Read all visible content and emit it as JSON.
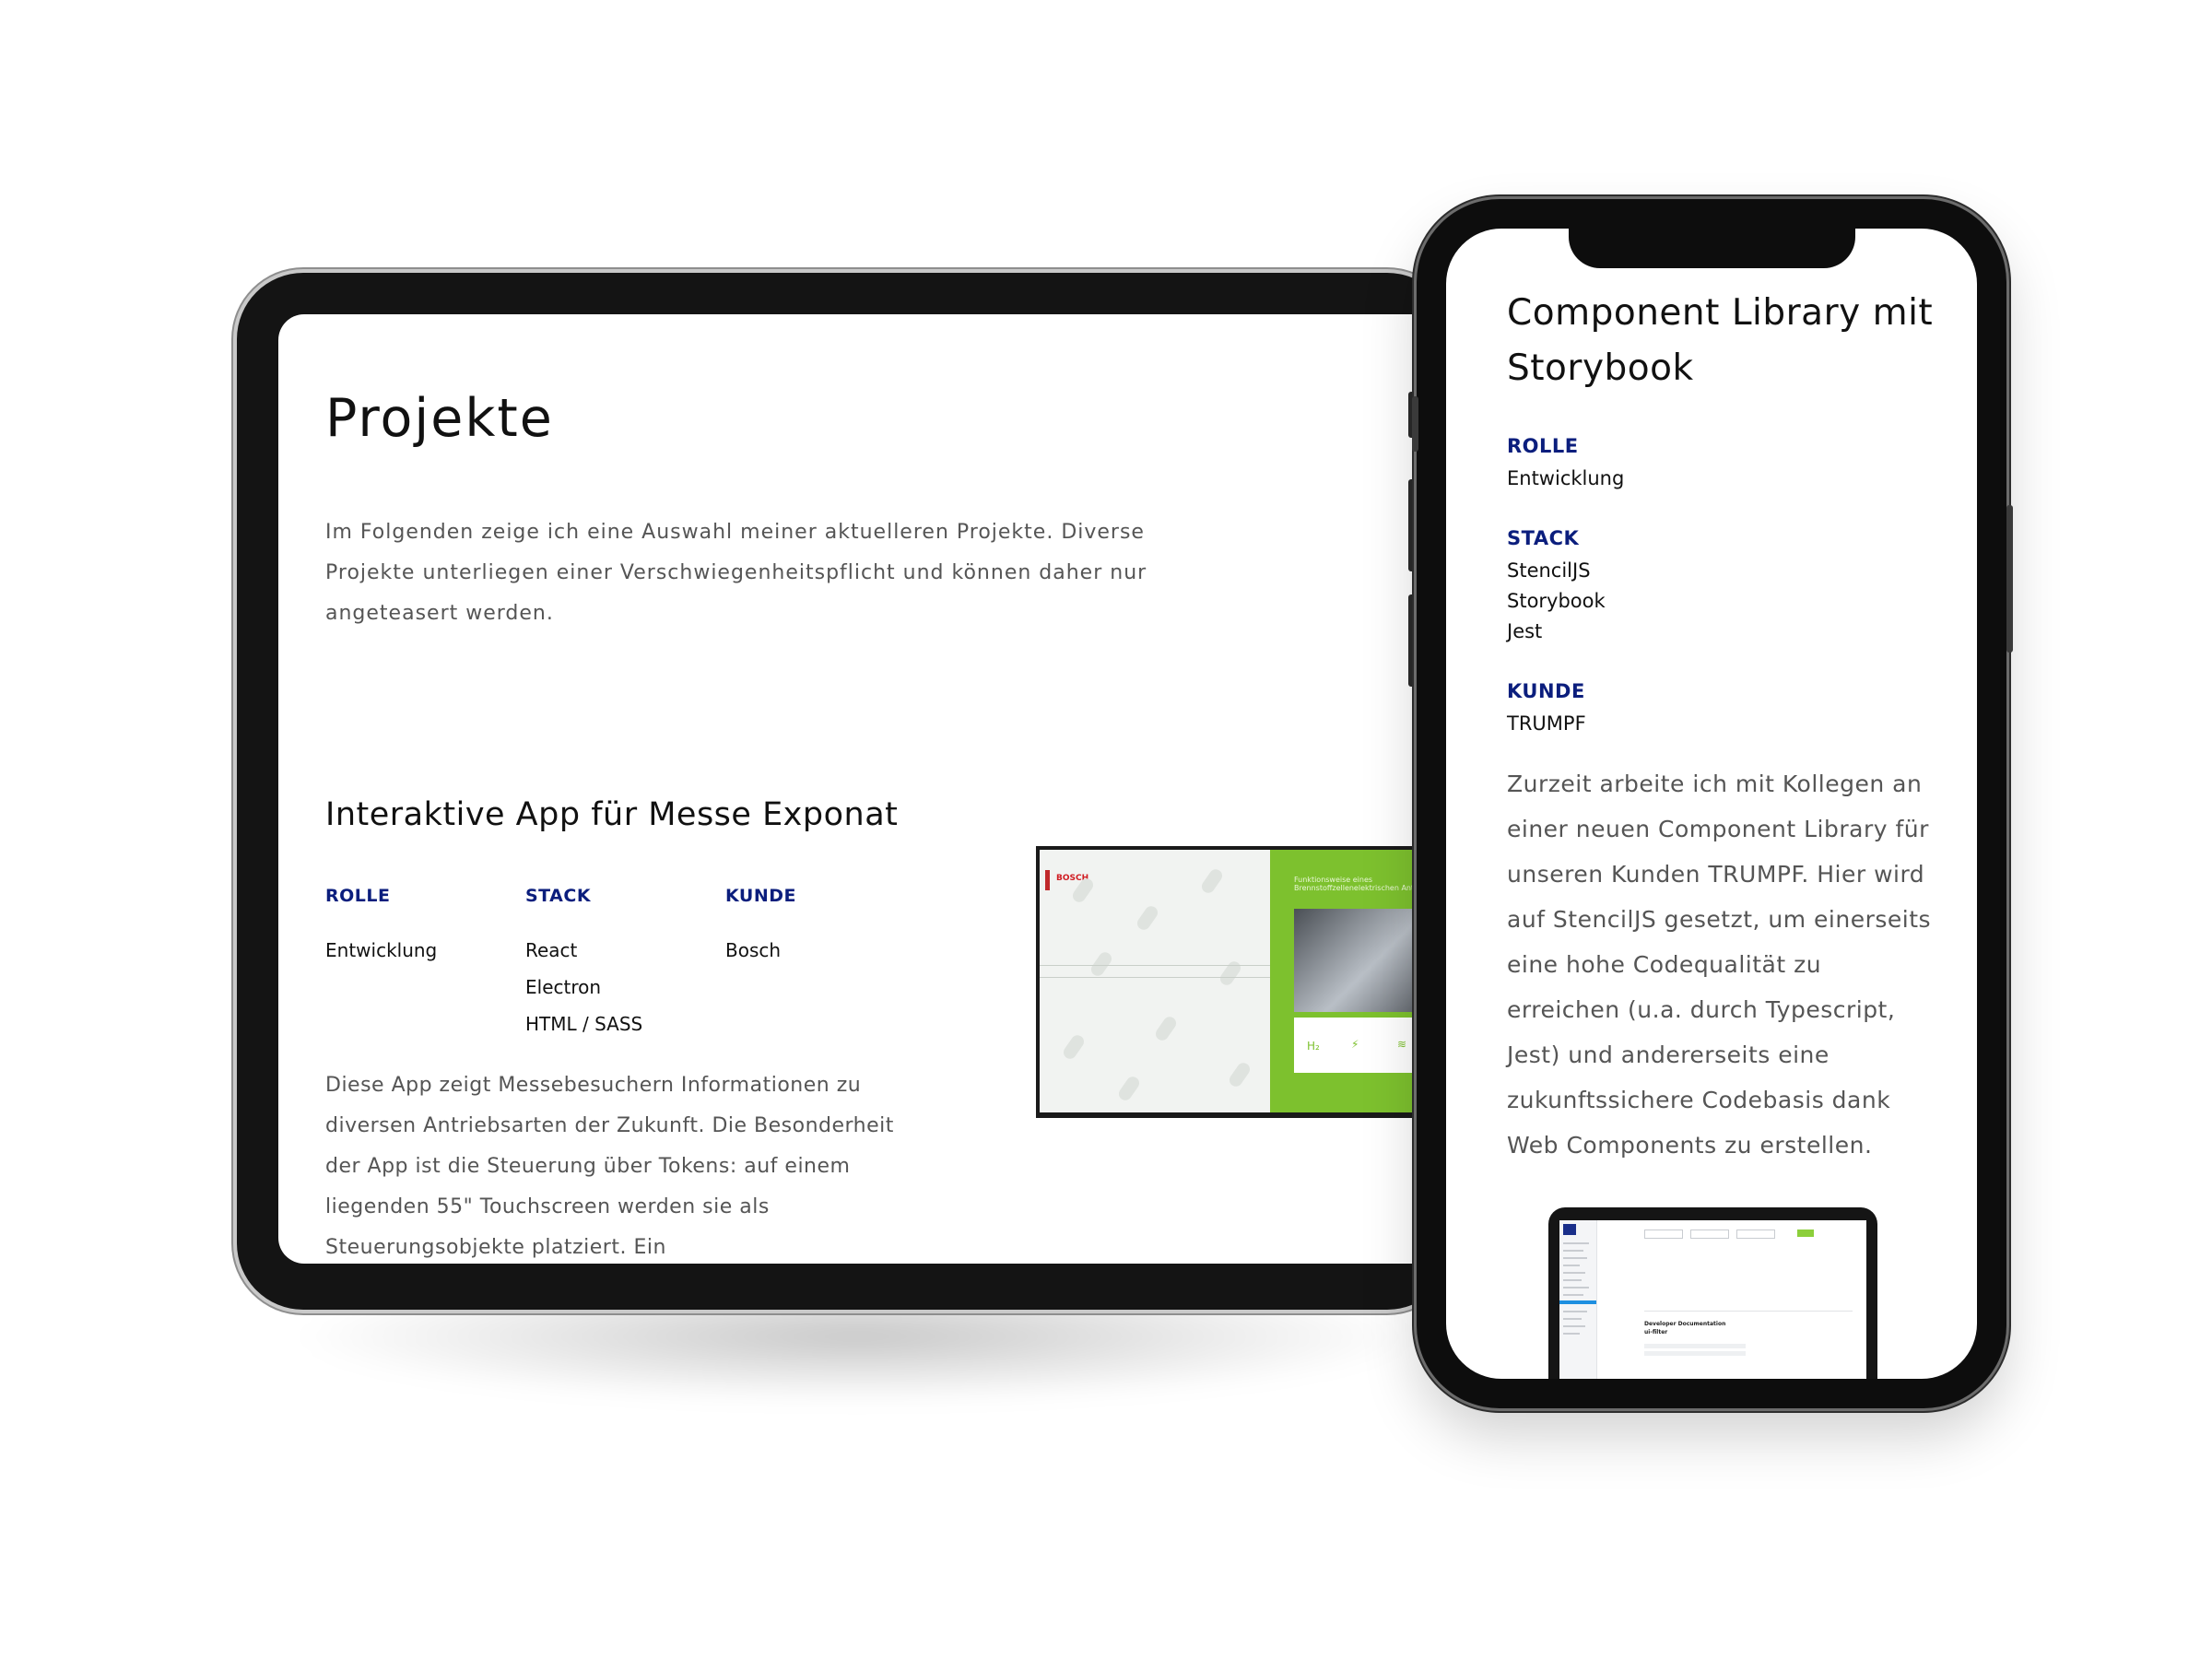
{
  "tablet": {
    "page_title": "Projekte",
    "intro": "Im Folgenden zeige ich eine Auswahl meiner aktuelleren Projekte. Diverse Projekte unterliegen einer Verschwiegenheitspflicht und können daher nur angeteasert werden.",
    "project": {
      "title": "Interaktive App für Messe Exponat",
      "rolle_label": "ROLLE",
      "rolle": "Entwicklung",
      "stack_label": "STACK",
      "stack": [
        "React",
        "Electron",
        "HTML / SASS"
      ],
      "kunde_label": "KUNDE",
      "kunde": "Bosch",
      "description": "Diese App zeigt Messebesuchern Informationen zu diversen Antriebsarten der Zukunft. Die Besonderheit der App ist die Steuerung über Tokens: auf einem liegenden 55\" Touchscreen werden sie als Steuerungsobjekte platziert. Ein",
      "thumbnail_brand": "BOSCH",
      "thumbnail_heading": "Funktionsweise eines Brennstoffzellenelektrischen Antriebs"
    }
  },
  "phone": {
    "project": {
      "title": "Component Library mit Storybook",
      "rolle_label": "ROLLE",
      "rolle": "Entwicklung",
      "stack_label": "STACK",
      "stack": [
        "StencilJS",
        "Storybook",
        "Jest"
      ],
      "kunde_label": "KUNDE",
      "kunde": "TRUMPF",
      "description": "Zurzeit arbeite ich mit Kollegen an einer neuen Component Library für unseren Kunden TRUMPF. Hier wird auf StencilJS gesetzt, um einerseits eine hohe Codequalität zu erreichen (u.a. durch Typescript, Jest) und andererseits eine zukunftssichere Codebasis dank Web Components zu erstellen.",
      "mini_doc_title": "Developer Documentation",
      "mini_doc_sub": "ui-filter"
    }
  },
  "colors": {
    "label_blue": "#0b1e7d",
    "text_gray": "#555555",
    "bosch_green": "#7dc12e",
    "bosch_red": "#d01c22"
  }
}
